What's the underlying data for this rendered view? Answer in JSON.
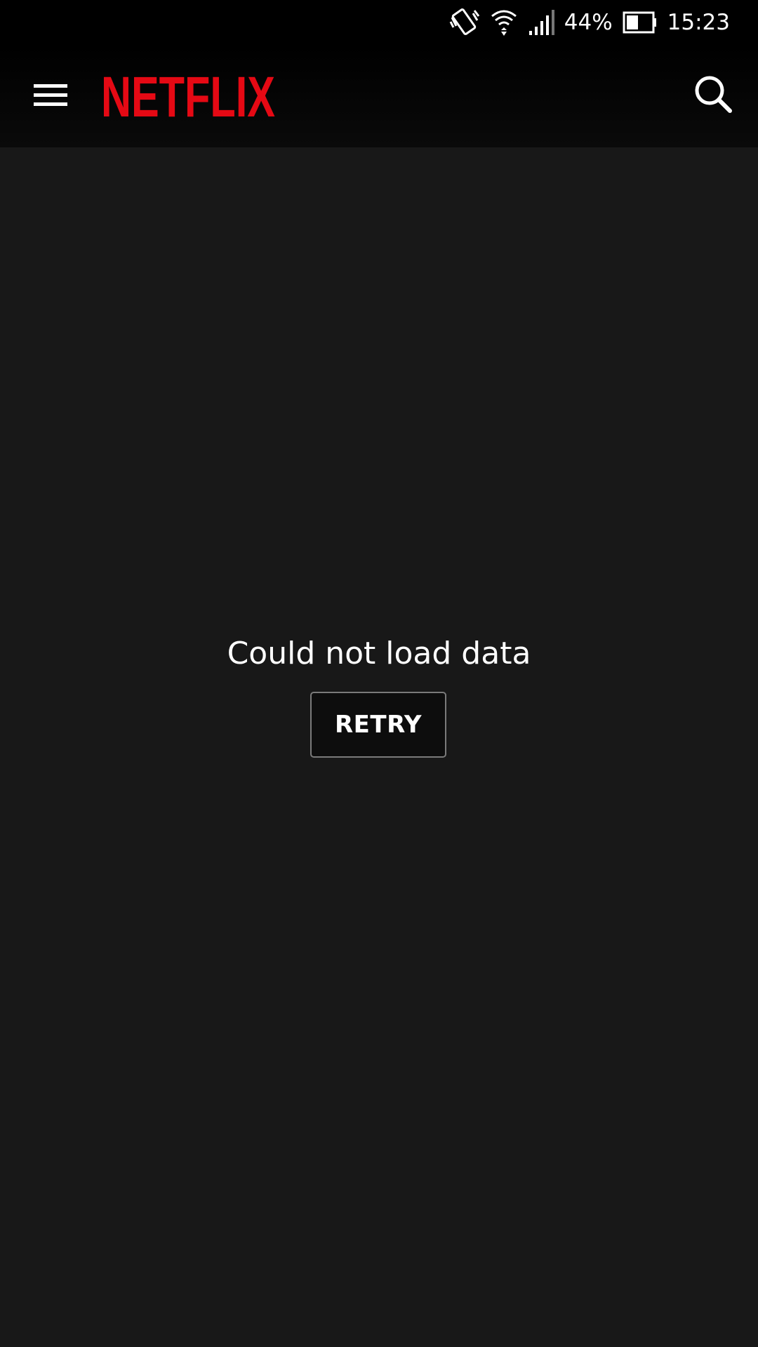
{
  "status_bar": {
    "battery_percent": "44%",
    "time": "15:23",
    "icons": [
      "vibrate-icon",
      "wifi-icon",
      "signal-icon",
      "battery-icon"
    ]
  },
  "app_bar": {
    "logo_text": "NETFLIX",
    "brand_color": "#E50914",
    "menu_icon": "hamburger-menu-icon",
    "search_icon": "search-icon"
  },
  "main": {
    "error_message": "Could not load data",
    "retry_label": "RETRY"
  }
}
